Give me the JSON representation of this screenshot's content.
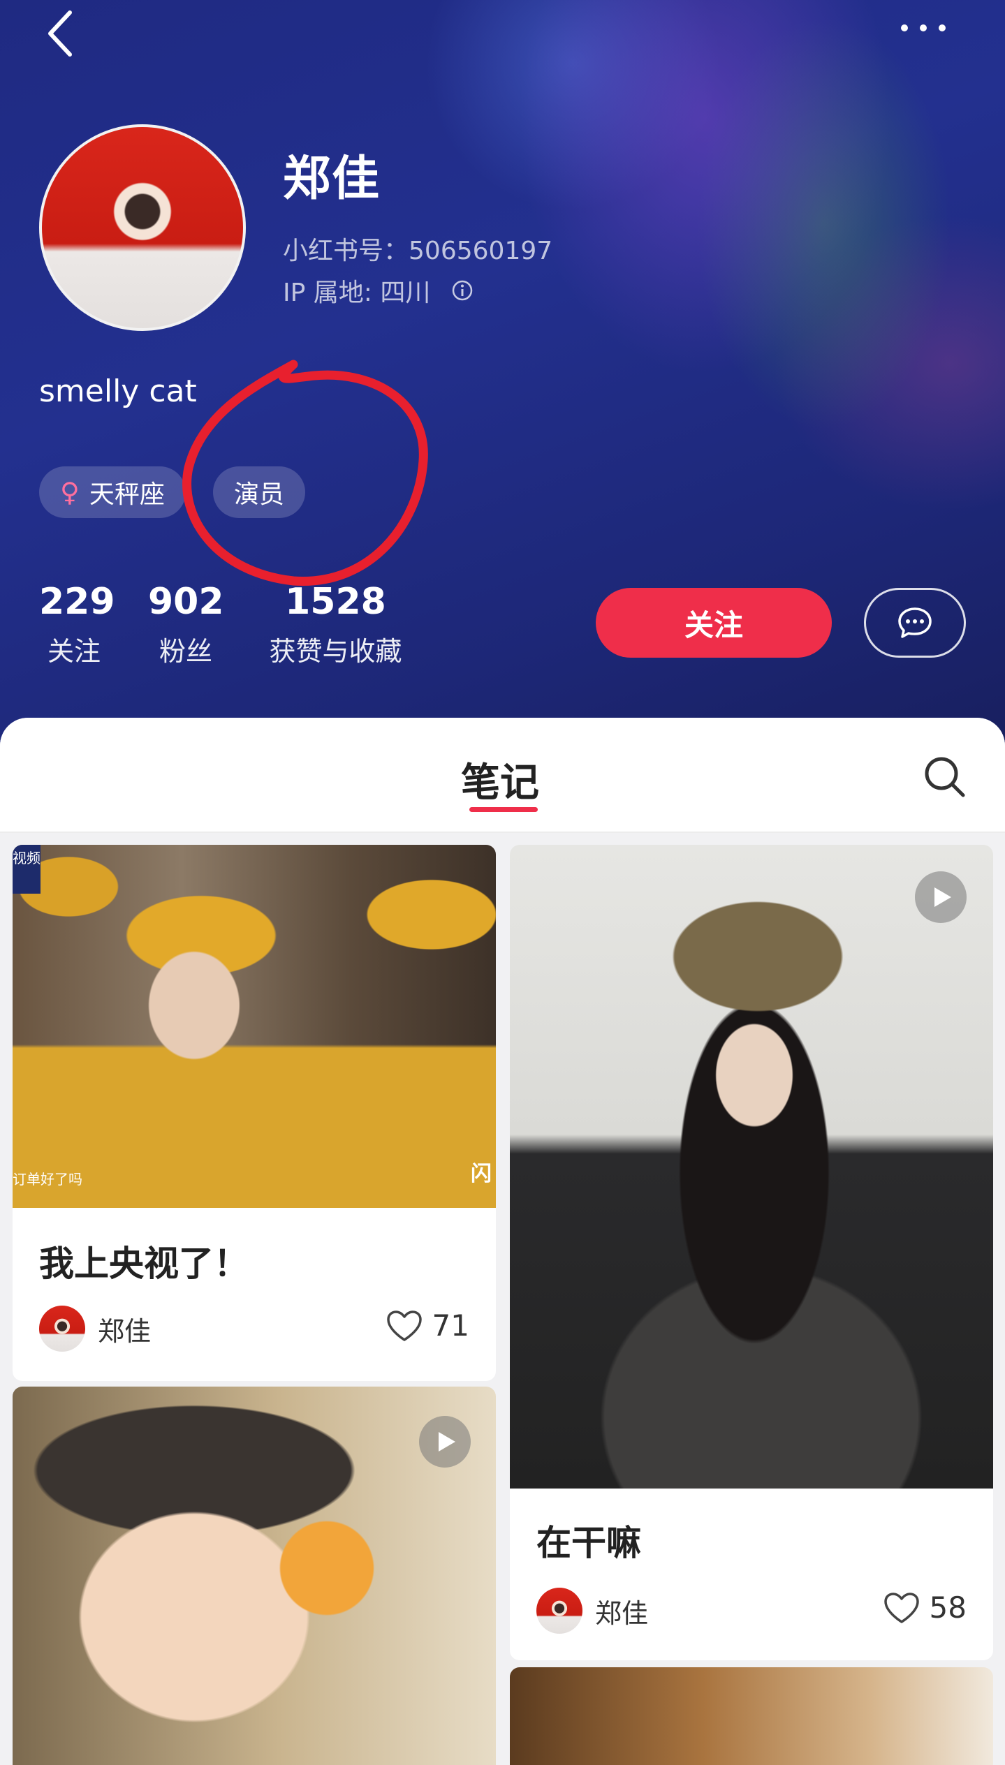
{
  "profile": {
    "name": "郑佳",
    "red_id_label": "小红书号：",
    "red_id": "506560197",
    "ip_location": "IP 属地: 四川",
    "bio": "smelly cat",
    "tags": [
      {
        "label": "天秤座",
        "icon": "female-icon"
      },
      {
        "label": "演员"
      }
    ],
    "stats": [
      {
        "value": "229",
        "label": "关注"
      },
      {
        "value": "902",
        "label": "粉丝"
      },
      {
        "value": "1528",
        "label": "获赞与收藏"
      }
    ],
    "follow_label": "关注"
  },
  "nav": {
    "back_icon": "chevron-left-icon",
    "more_icon": "more-dots-icon"
  },
  "tabs": {
    "active": "笔记"
  },
  "notes": [
    {
      "title": "我上央视了！",
      "author": "郑佳",
      "likes": "71",
      "badge": "视频",
      "caption": "订单好了吗",
      "watermark": "闪"
    },
    {
      "title": "在干嘛",
      "author": "郑佳",
      "likes": "58"
    }
  ],
  "colors": {
    "accent": "#ef2e4a",
    "header_bg": "#1f2a82",
    "annotation": "#e8202e"
  }
}
